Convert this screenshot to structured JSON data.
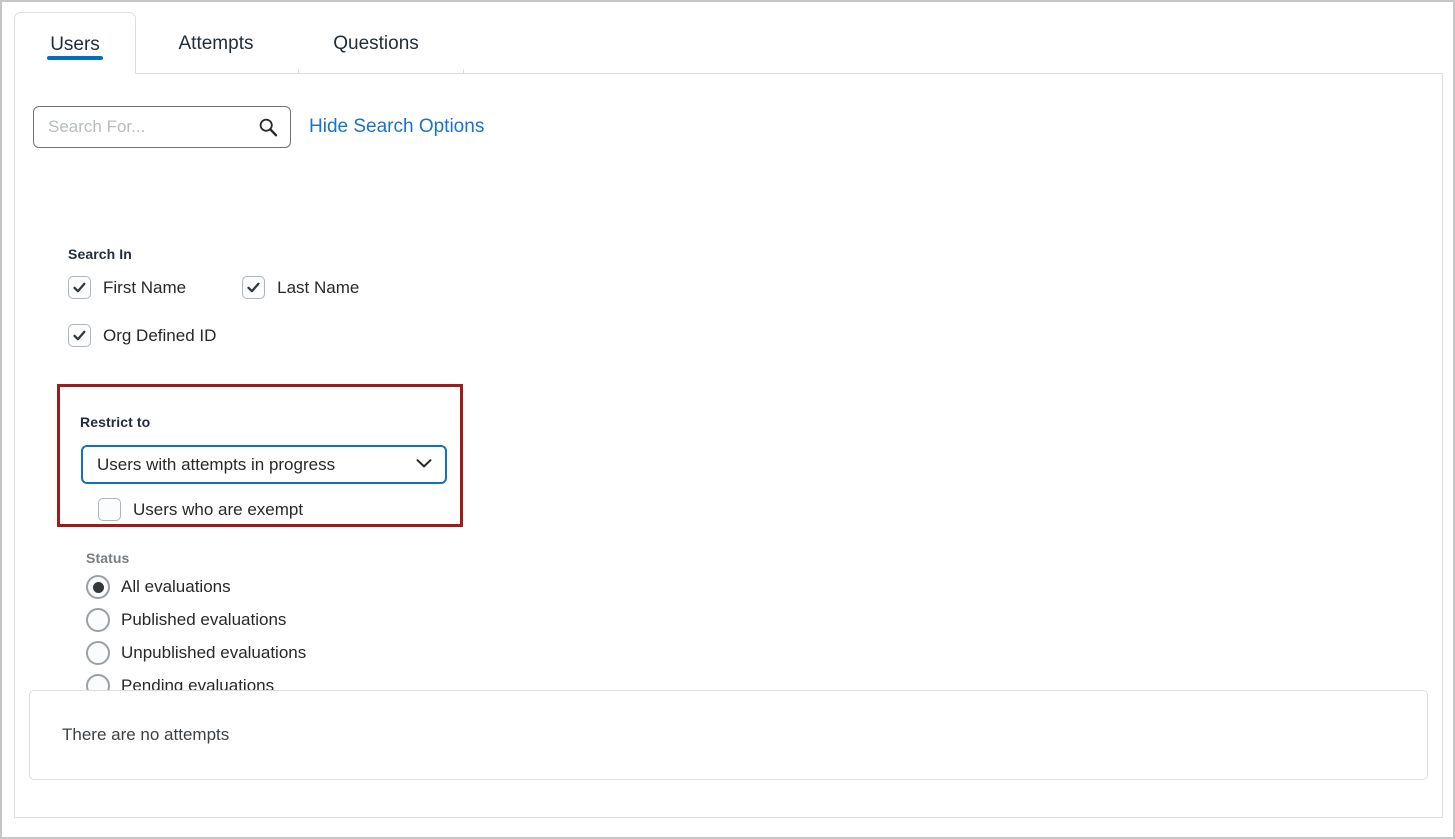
{
  "tabs": [
    {
      "label": "Users",
      "active": true
    },
    {
      "label": "Attempts",
      "active": false
    },
    {
      "label": "Questions",
      "active": false
    }
  ],
  "search": {
    "value": "",
    "placeholder": "Search For...",
    "icon": "search-icon",
    "toggle_link": "Hide Search Options"
  },
  "search_in": {
    "label": "Search In",
    "options": [
      {
        "label": "First Name",
        "checked": true
      },
      {
        "label": "Last Name",
        "checked": true
      },
      {
        "label": "Org Defined ID",
        "checked": true
      }
    ]
  },
  "restrict_to": {
    "label": "Restrict to",
    "highlight_color": "#9d1b1b",
    "dropdown": {
      "selected": "Users with attempts in progress",
      "focus_color": "#0f72c0",
      "icon": "chevron-down-icon"
    },
    "exempt": {
      "label": "Users who are exempt",
      "checked": false
    }
  },
  "status": {
    "label": "Status",
    "options": [
      {
        "label": "All evaluations",
        "selected": true
      },
      {
        "label": "Published evaluations",
        "selected": false
      },
      {
        "label": "Unpublished evaluations",
        "selected": false
      },
      {
        "label": "Pending evaluations",
        "selected": false
      }
    ]
  },
  "results": {
    "empty_message": "There are no attempts"
  },
  "colors": {
    "accent": "#006fbf",
    "link": "#1a73c4",
    "highlight": "#9d1b1b",
    "border": "#d8dee3"
  }
}
